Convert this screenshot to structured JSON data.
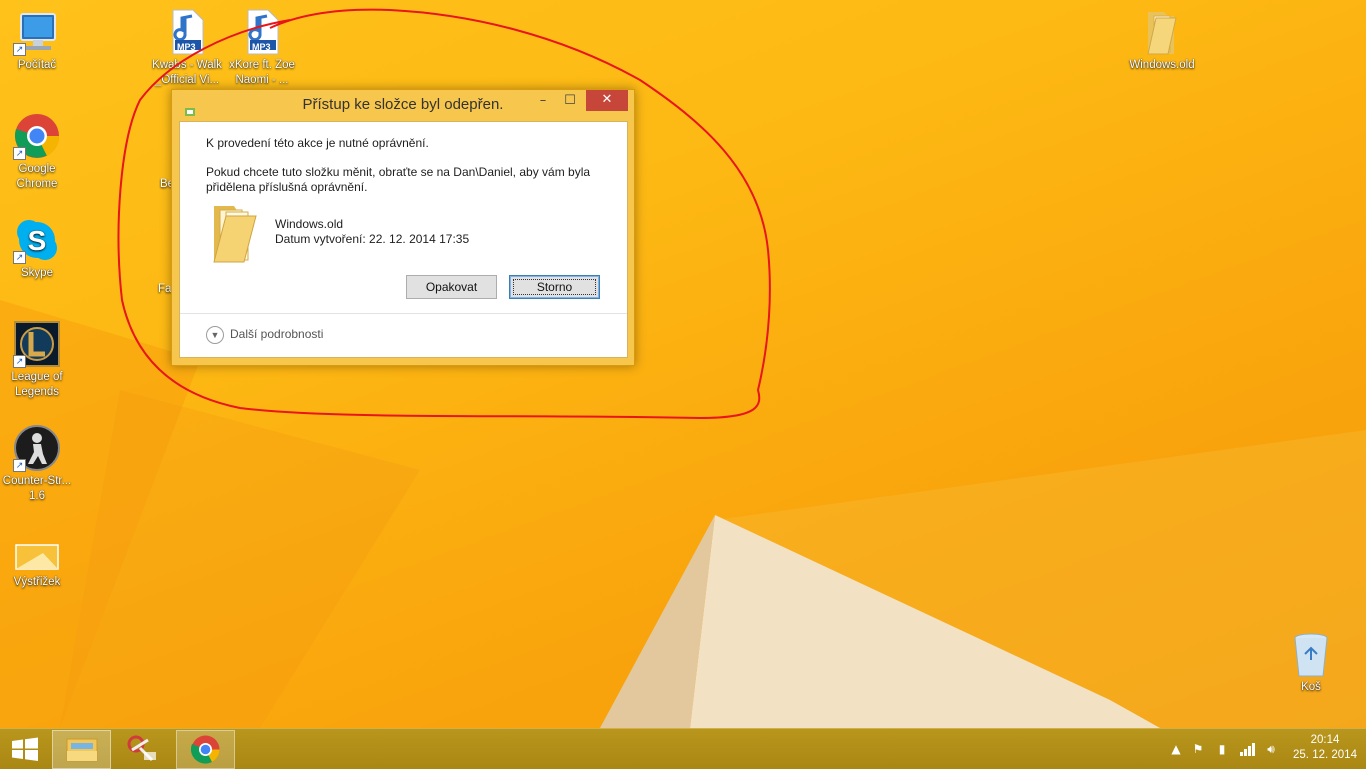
{
  "desktop": {
    "icons": [
      {
        "name": "computer",
        "label": "Počítač",
        "label2": ""
      },
      {
        "name": "mp3-kwabs",
        "label": "Kwabs - Walk",
        "label2": "_Official Vi..."
      },
      {
        "name": "mp3-xkore",
        "label": "xKore ft. Zoe",
        "label2": "Naomi - ..."
      },
      {
        "name": "windows-old",
        "label": "Windows.old",
        "label2": ""
      },
      {
        "name": "google-chrome",
        "label": "Google",
        "label2": "Chrome"
      },
      {
        "name": "skype",
        "label": "Skype",
        "label2": ""
      },
      {
        "name": "league-of-legends",
        "label": "League of",
        "label2": "Legends"
      },
      {
        "name": "counter-strike",
        "label": "Counter-Str...",
        "label2": "1.6"
      },
      {
        "name": "vystrizek",
        "label": "Výstřižek",
        "label2": ""
      },
      {
        "name": "recycle-bin",
        "label": "Koš",
        "label2": ""
      }
    ],
    "hidden_fragments": {
      "be": "Be",
      "fa": "Fa"
    },
    "mp3_badge": "MP3"
  },
  "dialog": {
    "title": "Přístup ke složce byl odepřen.",
    "message1": "K provedení této akce je nutné oprávnění.",
    "message2": "Pokud chcete tuto složku měnit, obraťte se na Dan\\Daniel, aby vám byla přidělena příslušná oprávnění.",
    "folder_name": "Windows.old",
    "folder_date": "Datum vytvoření: 22. 12. 2014 17:35",
    "retry_label": "Opakovat",
    "cancel_label": "Storno",
    "details_label": "Další podrobnosti",
    "controls": {
      "minimize": "–",
      "maximize": "☐",
      "close": "✕"
    }
  },
  "taskbar": {
    "pinned": [
      "file-explorer-icon",
      "snipping-tool-icon",
      "chrome-icon"
    ],
    "clock_time": "20:14",
    "clock_date": "25. 12. 2014"
  },
  "colors": {
    "desktop_accent": "#fdb813",
    "annotation": "#e8151c",
    "close_button": "#c7463a"
  }
}
